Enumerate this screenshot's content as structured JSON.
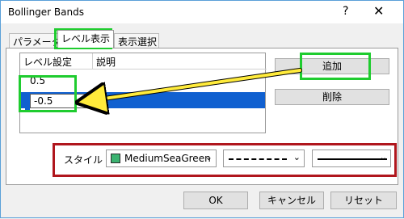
{
  "window": {
    "title": "Bollinger Bands",
    "help_glyph": "?",
    "close_glyph": "✕"
  },
  "tabs": [
    {
      "label": "パラメーター"
    },
    {
      "label": "レベル表示"
    },
    {
      "label": "表示選択"
    }
  ],
  "levels": {
    "headers": {
      "level": "レベル設定",
      "description": "説明"
    },
    "rows": [
      {
        "level": "0.5",
        "description": ""
      },
      {
        "level": "-0.5",
        "description": ""
      }
    ]
  },
  "buttons": {
    "add": "追加",
    "delete": "削除",
    "ok": "OK",
    "cancel": "キャンセル",
    "reset": "リセット"
  },
  "style": {
    "label": "スタイル :",
    "color_name": "MediumSeaGreen",
    "color_hex": "#3cb371",
    "dash_style": "dash-dot",
    "line_width": "solid"
  },
  "annotation_colors": {
    "green": "#1fcc2f",
    "red": "#b0161d",
    "arrow": "#ffeb3b"
  }
}
